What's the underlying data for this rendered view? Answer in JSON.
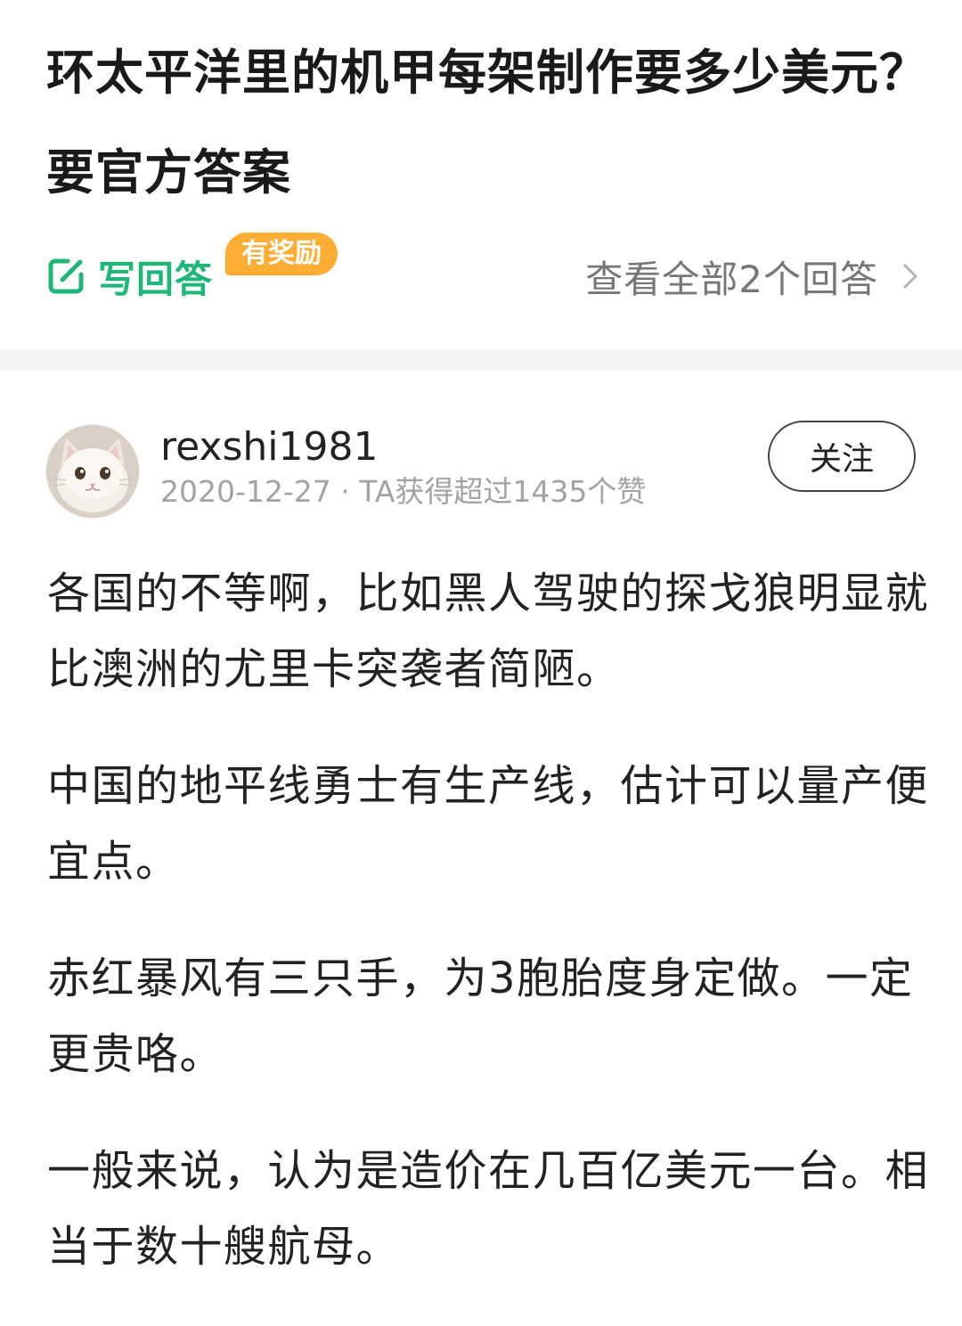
{
  "question": {
    "title": "环太平洋里的机甲每架制作要多少美元？要官方答案",
    "write_answer_label": "写回答",
    "reward_badge": "有奖励",
    "view_all_label": "查看全部2个回答"
  },
  "answer": {
    "author_name": "rexshi1981",
    "meta": "2020-12-27 · TA获得超过1435个赞",
    "follow_label": "关注",
    "paragraphs": [
      "各国的不等啊，比如黑人驾驶的探戈狼明显就比澳洲的尤里卡突袭者简陋。",
      "中国的地平线勇士有生产线，估计可以量产便宜点。",
      "赤红暴风有三只手，为3胞胎度身定做。一定更贵咯。",
      "一般来说，认为是造价在几百亿美元一台。相当于数十艘航母。"
    ]
  },
  "icons": {
    "write": "edit-pencil-icon",
    "chevron": "chevron-right-icon",
    "avatar": "cat-avatar"
  },
  "colors": {
    "accent_green": "#1fb777",
    "reward_orange": "#ffae35",
    "muted_text": "#a3a3a3",
    "section_gap": "#f2f3f5"
  }
}
